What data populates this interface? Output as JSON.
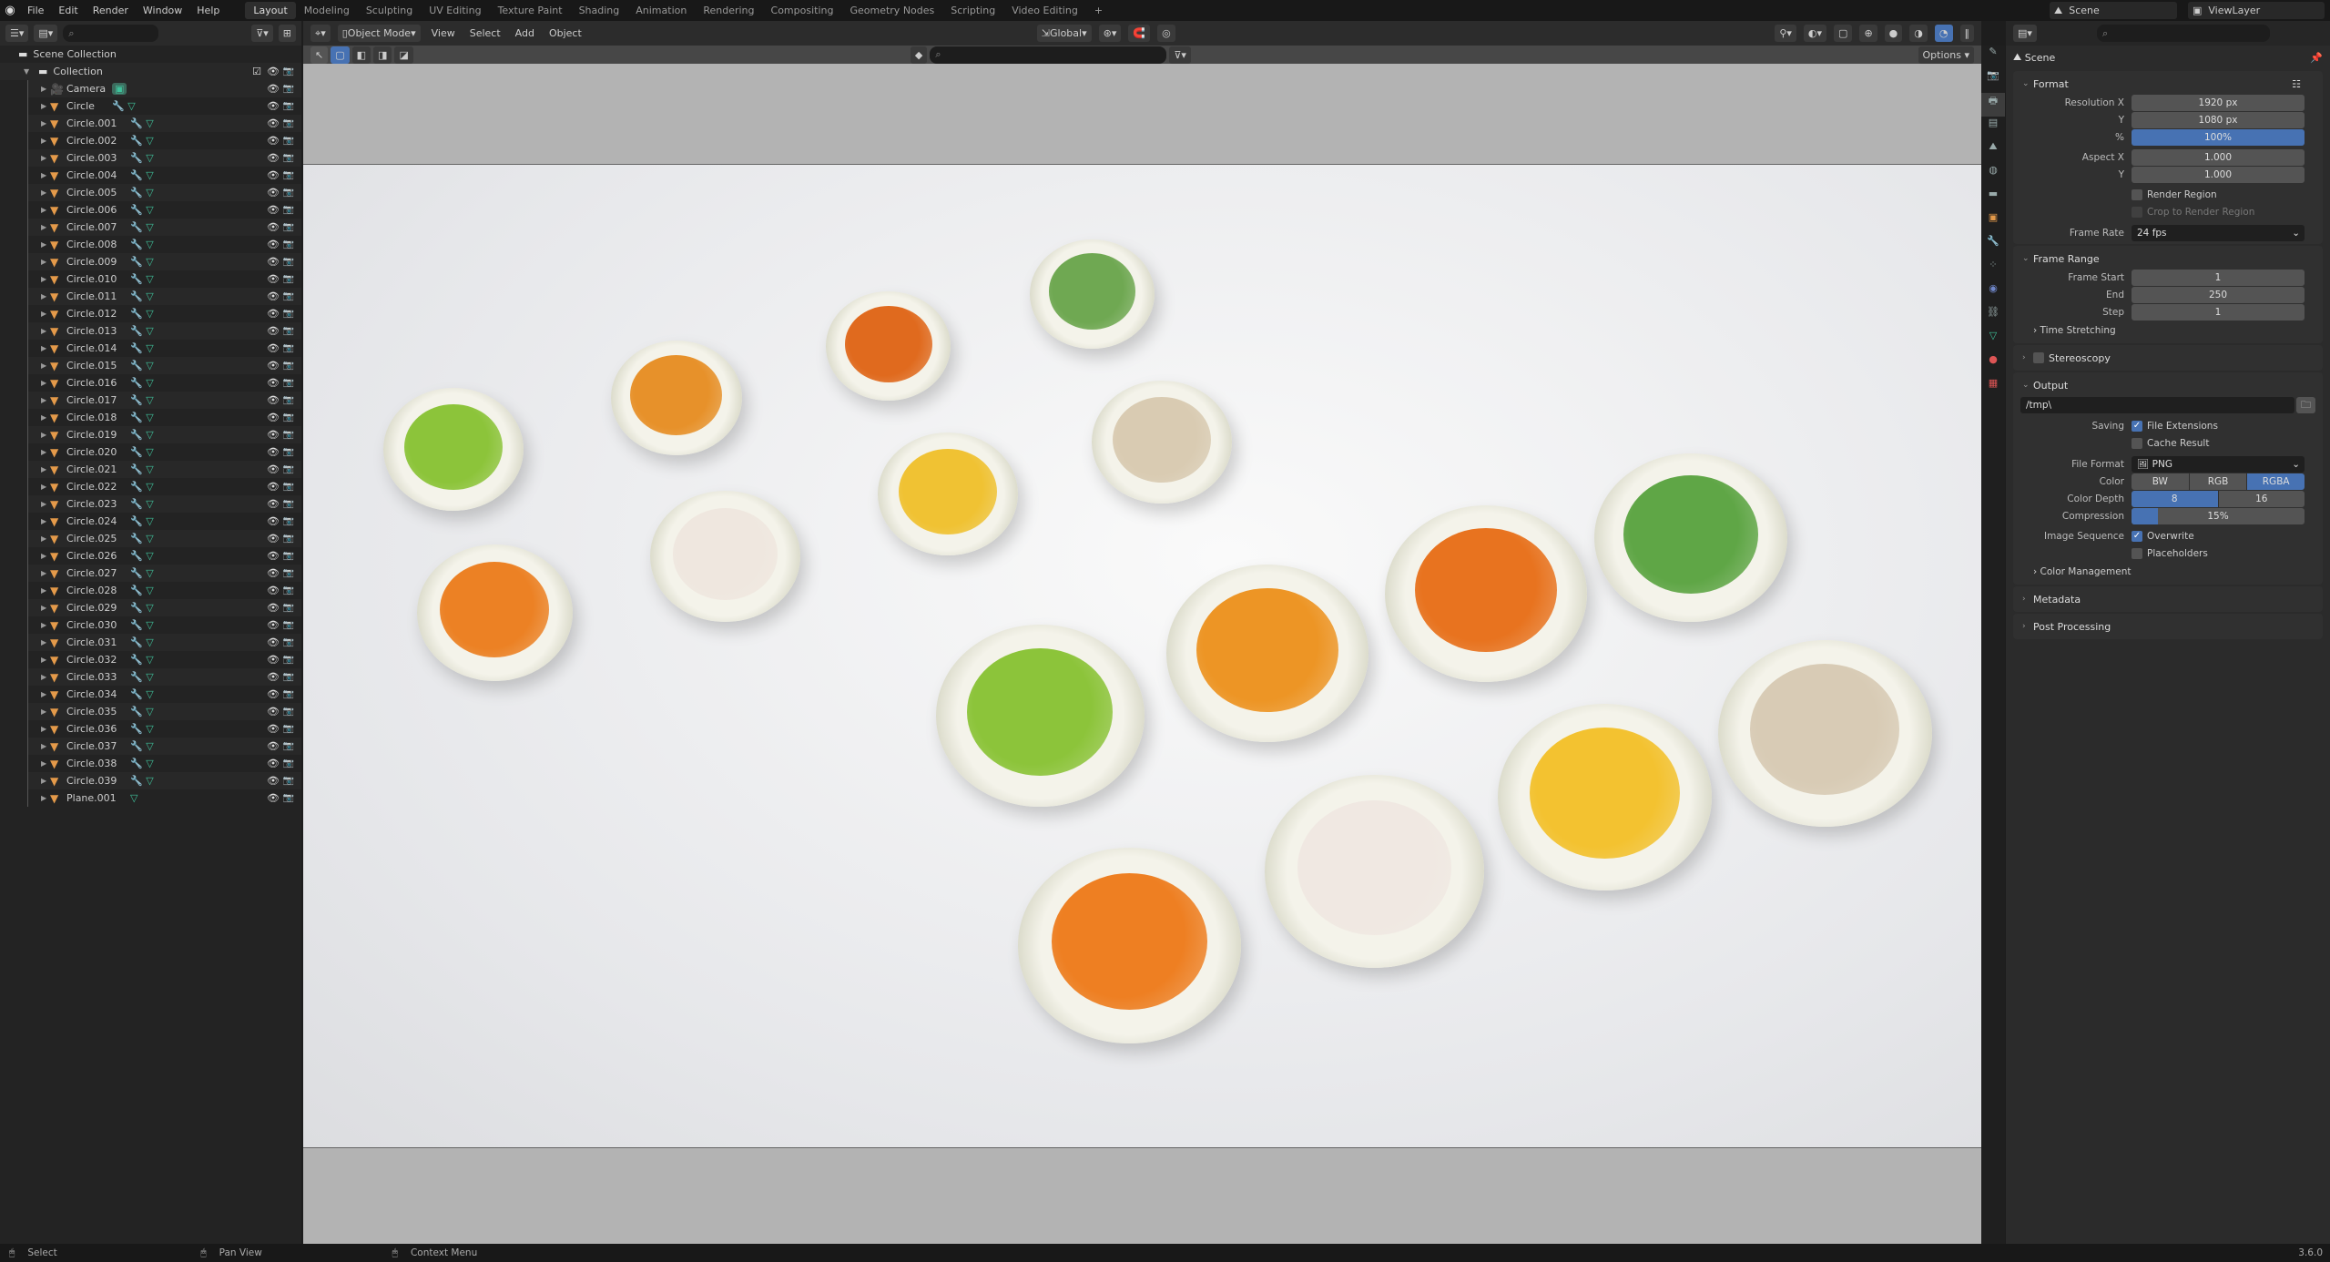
{
  "menu": [
    "File",
    "Edit",
    "Render",
    "Window",
    "Help"
  ],
  "workspaces": [
    "Layout",
    "Modeling",
    "Sculpting",
    "UV Editing",
    "Texture Paint",
    "Shading",
    "Animation",
    "Rendering",
    "Compositing",
    "Geometry Nodes",
    "Scripting",
    "Video Editing",
    "+"
  ],
  "active_workspace": "Layout",
  "scene_selector": "Scene",
  "viewlayer_selector": "ViewLayer",
  "outliner": {
    "scene_collection": "Scene Collection",
    "collection": "Collection",
    "objects": [
      "Camera",
      "Circle",
      "Circle.001",
      "Circle.002",
      "Circle.003",
      "Circle.004",
      "Circle.005",
      "Circle.006",
      "Circle.007",
      "Circle.008",
      "Circle.009",
      "Circle.010",
      "Circle.011",
      "Circle.012",
      "Circle.013",
      "Circle.014",
      "Circle.015",
      "Circle.016",
      "Circle.017",
      "Circle.018",
      "Circle.019",
      "Circle.020",
      "Circle.021",
      "Circle.022",
      "Circle.023",
      "Circle.024",
      "Circle.025",
      "Circle.026",
      "Circle.027",
      "Circle.028",
      "Circle.029",
      "Circle.030",
      "Circle.031",
      "Circle.032",
      "Circle.033",
      "Circle.034",
      "Circle.035",
      "Circle.036",
      "Circle.037",
      "Circle.038",
      "Circle.039",
      "Plane.001"
    ]
  },
  "viewport": {
    "mode": "Object Mode",
    "menus": [
      "View",
      "Select",
      "Add",
      "Object"
    ],
    "orientation": "Global",
    "options": "Options"
  },
  "properties": {
    "title": "Scene",
    "format": {
      "title": "Format",
      "res_x_label": "Resolution X",
      "res_x": "1920 px",
      "res_y_label": "Y",
      "res_y": "1080 px",
      "pct_label": "%",
      "pct": "100%",
      "aspect_x_label": "Aspect X",
      "aspect_x": "1.000",
      "aspect_y_label": "Y",
      "aspect_y": "1.000",
      "render_region": "Render Region",
      "crop": "Crop to Render Region",
      "frame_rate_label": "Frame Rate",
      "frame_rate": "24 fps"
    },
    "frame_range": {
      "title": "Frame Range",
      "start_label": "Frame Start",
      "start": "1",
      "end_label": "End",
      "end": "250",
      "step_label": "Step",
      "step": "1",
      "time_stretching": "Time Stretching"
    },
    "stereoscopy": "Stereoscopy",
    "output": {
      "title": "Output",
      "path": "/tmp\\",
      "saving_label": "Saving",
      "file_ext": "File Extensions",
      "file_ext_checked": true,
      "cache": "Cache Result",
      "format_label": "File Format",
      "format": "PNG",
      "color_label": "Color",
      "color_opts": [
        "BW",
        "RGB",
        "RGBA"
      ],
      "color_selected": "RGBA",
      "depth_label": "Color Depth",
      "depth_opts": [
        "8",
        "16"
      ],
      "depth_selected": "8",
      "compression_label": "Compression",
      "compression": "15%",
      "compression_value": 15,
      "seq_label": "Image Sequence",
      "overwrite": "Overwrite",
      "overwrite_checked": true,
      "placeholders": "Placeholders",
      "color_mgmt": "Color Management"
    },
    "metadata": "Metadata",
    "post_processing": "Post Processing"
  },
  "status": {
    "select": "Select",
    "pan": "Pan View",
    "context": "Context Menu",
    "version": "3.6.0"
  }
}
